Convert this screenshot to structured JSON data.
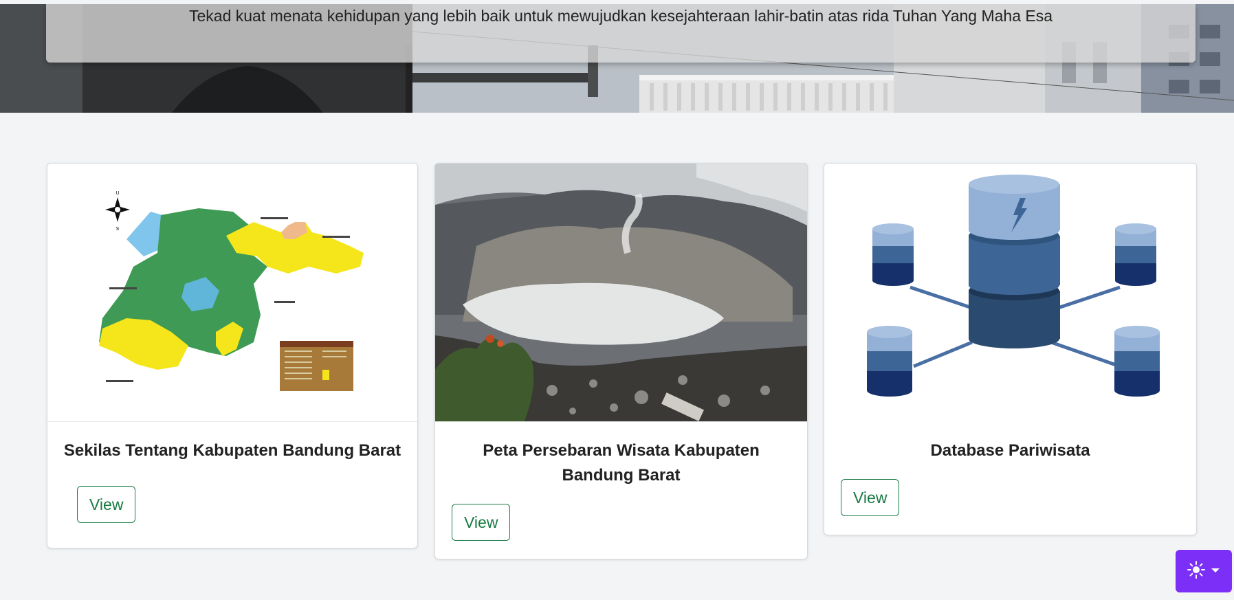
{
  "hero": {
    "motto": "Tekad kuat menata kehidupan yang lebih baik untuk mewujudkan kesejahteraan lahir-batin atas rida Tuhan Yang Maha Esa"
  },
  "cards": [
    {
      "title": "Sekilas Tentang Kabupaten Bandung Barat",
      "button": "View",
      "image": "regency-map"
    },
    {
      "title": "Peta Persebaran Wisata Kabupaten Bandung Barat",
      "button": "View",
      "image": "crater-photo"
    },
    {
      "title": "Database Pariwisata",
      "button": "View",
      "image": "database-illustration"
    }
  ],
  "theme_toggle": {
    "icon": "sun-icon",
    "caret": "caret-down-icon"
  },
  "colors": {
    "accent": "#1a7a44",
    "toggle": "#7b2ff7",
    "background": "#f3f4f6"
  }
}
